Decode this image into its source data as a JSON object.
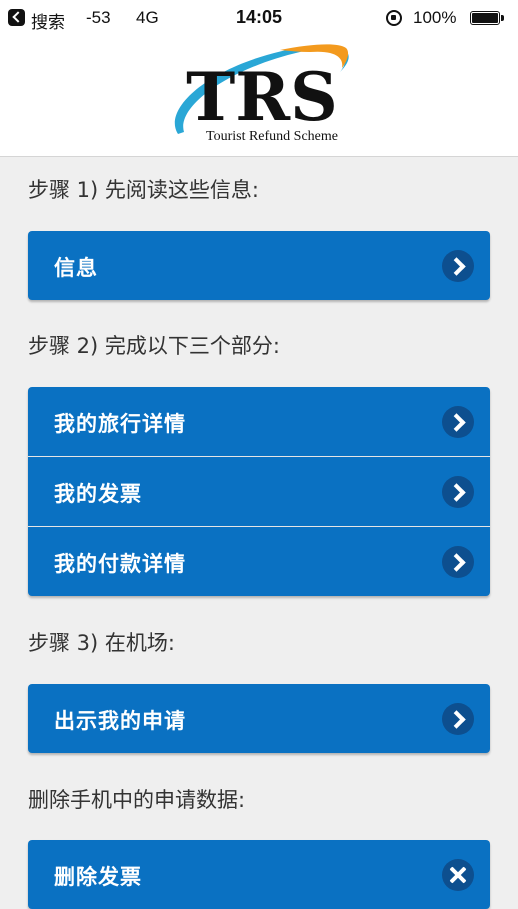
{
  "status_bar": {
    "back_label": "搜索",
    "signal": "-53",
    "network": "4G",
    "time": "14:05",
    "battery": "100%"
  },
  "logo": {
    "wordmark": "TRS",
    "tagline": "Tourist Refund Scheme"
  },
  "step1": {
    "label": "步骤 1) 先阅读这些信息:",
    "info_button": "信息"
  },
  "step2": {
    "label": "步骤 2) 完成以下三个部分:",
    "items": [
      {
        "label": "我的旅行详情"
      },
      {
        "label": "我的发票"
      },
      {
        "label": "我的付款详情"
      }
    ]
  },
  "step3": {
    "label": "步骤 3) 在机场:",
    "show_button": "出示我的申请"
  },
  "delete_section": {
    "label": "删除手机中的申请数据:",
    "delete_button": "删除发票"
  },
  "colors": {
    "button_blue": "#0a71c2",
    "icon_circle": "#0d4f8f",
    "background": "#efefef"
  }
}
